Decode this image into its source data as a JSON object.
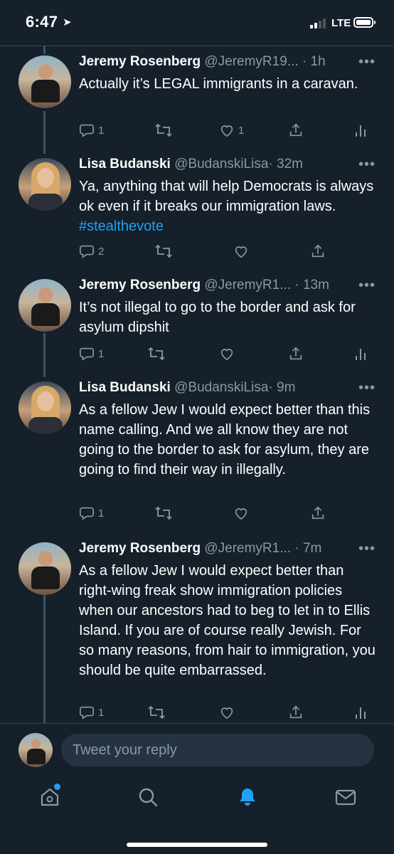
{
  "status": {
    "time": "6:47",
    "network": "LTE"
  },
  "tweets": [
    {
      "name": "Jeremy Rosenberg",
      "handle": "@JeremyR19...",
      "time": "· 1h",
      "text": "Actually it’s LEGAL immigrants in a caravan.",
      "reply_count": "1",
      "like_count": "1",
      "avatar": "jeremy"
    },
    {
      "name": "Lisa Budanski",
      "handle": "@BudanskiLisa",
      "time": "· 32m",
      "text": "Ya, anything that will help Democrats is always ok even if it breaks our immigration laws.",
      "hashtag": "#stealthevote",
      "reply_count": "2",
      "like_count": "",
      "avatar": "lisa"
    },
    {
      "name": "Jeremy Rosenberg",
      "handle": "@JeremyR1...",
      "time": "· 13m",
      "text": "It’s not illegal to go to the border and ask for asylum dipshit",
      "reply_count": "1",
      "like_count": "",
      "avatar": "jeremy"
    },
    {
      "name": "Lisa Budanski",
      "handle": "@BudanskiLisa",
      "time": "· 9m",
      "text": "As a fellow Jew I would expect better than this name calling.  And we all know they are not going to the border to ask for asylum, they are going to find their way in illegally.",
      "reply_count": "1",
      "like_count": "",
      "avatar": "lisa"
    },
    {
      "name": "Jeremy Rosenberg",
      "handle": "@JeremyR1...",
      "time": "· 7m",
      "text": "As a fellow Jew I would expect better than right-wing freak show immigration policies when our ancestors had to beg to let in to Ellis Island. If you are of course really Jewish. For so many reasons, from hair to immigration, you should be quite embarrassed.",
      "reply_count": "1",
      "like_count": "",
      "avatar": "jeremy"
    }
  ],
  "reply": {
    "placeholder": "Tweet your reply"
  },
  "tabs": [
    "home-icon",
    "search-icon",
    "notifications-icon",
    "messages-icon"
  ],
  "colors": {
    "background": "#15202b",
    "accent": "#1da1f2",
    "muted": "#8899a6"
  }
}
